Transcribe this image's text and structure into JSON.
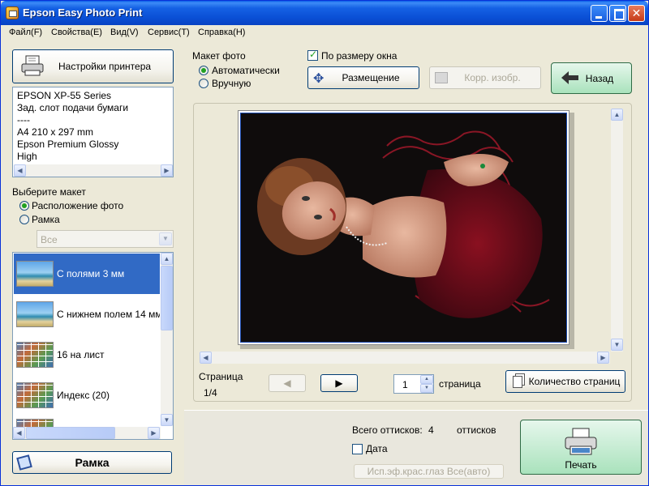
{
  "window": {
    "title": "Epson Easy Photo Print"
  },
  "menu": [
    "Файл(F)",
    "Свойства(E)",
    "Вид(V)",
    "Сервис(T)",
    "Справка(H)"
  ],
  "printer_settings_button": "Настройки принтера",
  "printer_info": [
    "EPSON XP-55 Series",
    "Зад. слот подачи бумаги",
    "----",
    "A4 210 x 297 mm",
    "Epson Premium Glossy",
    "High"
  ],
  "layout_group": {
    "title": "Выберите макет",
    "option_layout": "Расположение фото",
    "option_frame": "Рамка",
    "filter_value": "Все"
  },
  "layout_items": [
    {
      "label": "С полями 3 мм",
      "thumb": "beach",
      "selected": true
    },
    {
      "label": "С нижнем полем 14 мм",
      "thumb": "beach",
      "selected": false
    },
    {
      "label": "16 на лист",
      "thumb": "grid",
      "selected": false
    },
    {
      "label": "Индекс (20)",
      "thumb": "grid",
      "selected": false
    }
  ],
  "frame_button": "Рамка",
  "photo_layout": {
    "title": "Макет фото",
    "auto": "Автоматически",
    "manual": "Вручную"
  },
  "fit_window_label": "По размеру окна",
  "placement_button": "Размещение",
  "correct_image_button": "Корр. изобр.",
  "back_button": "Назад",
  "page_nav": {
    "label": "Страница",
    "value": "1/4",
    "copies_value": "1",
    "copies_unit": "страница",
    "page_count_button": "Количество страниц"
  },
  "totals": {
    "label": "Всего оттисков:",
    "count": "4",
    "unit": "оттисков"
  },
  "date_label": "Дата",
  "red_eye_label": "Исп.эф.крас.глаз Все(авто)",
  "print_button": "Печать"
}
